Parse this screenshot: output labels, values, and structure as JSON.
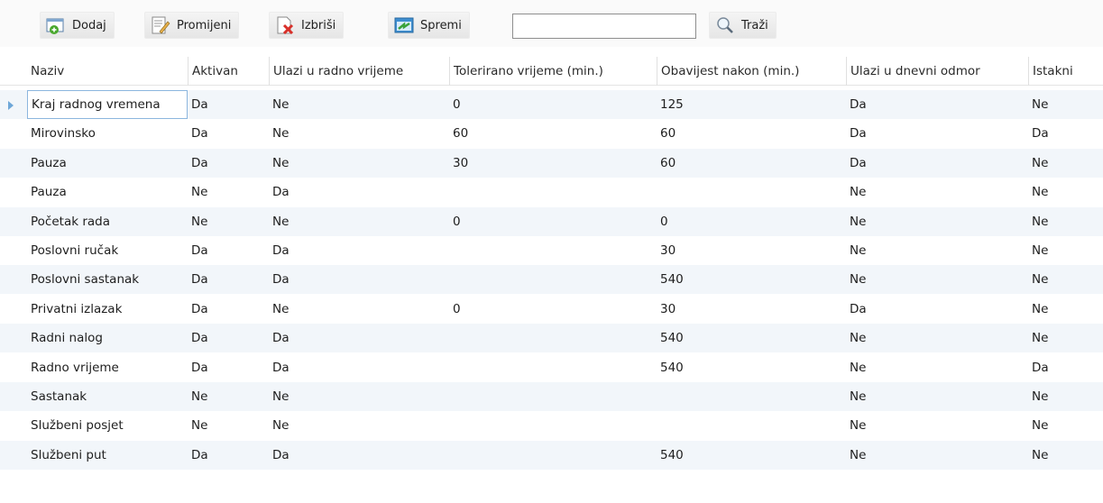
{
  "toolbar": {
    "add_label": "Dodaj",
    "edit_label": "Promijeni",
    "delete_label": "Izbriši",
    "save_label": "Spremi",
    "search_value": "",
    "search_label": "Traži"
  },
  "table": {
    "columns": [
      "Naziv",
      "Aktivan",
      "Ulazi u radno vrijeme",
      "Tolerirano vrijeme (min.)",
      "Obavijest nakon (min.)",
      "Ulazi u dnevni odmor",
      "Istakni"
    ],
    "rows": [
      [
        "Kraj radnog vremena",
        "Da",
        "Ne",
        "0",
        "125",
        "Da",
        "Ne"
      ],
      [
        "Mirovinsko",
        "Da",
        "Ne",
        "60",
        "60",
        "Da",
        "Da"
      ],
      [
        "Pauza",
        "Da",
        "Ne",
        "30",
        "60",
        "Da",
        "Ne"
      ],
      [
        "Pauza",
        "Ne",
        "Da",
        "",
        "",
        "Ne",
        "Ne"
      ],
      [
        "Početak rada",
        "Ne",
        "Ne",
        "0",
        "0",
        "Ne",
        "Ne"
      ],
      [
        "Poslovni ručak",
        "Da",
        "Da",
        "",
        "30",
        "Ne",
        "Ne"
      ],
      [
        "Poslovni sastanak",
        "Da",
        "Da",
        "",
        "540",
        "Ne",
        "Ne"
      ],
      [
        "Privatni izlazak",
        "Da",
        "Ne",
        "0",
        "30",
        "Da",
        "Ne"
      ],
      [
        "Radni nalog",
        "Da",
        "Da",
        "",
        "540",
        "Ne",
        "Ne"
      ],
      [
        "Radno vrijeme",
        "Da",
        "Da",
        "",
        "540",
        "Ne",
        "Da"
      ],
      [
        "Sastanak",
        "Ne",
        "Ne",
        "",
        "",
        "Ne",
        "Ne"
      ],
      [
        "Službeni posjet",
        "Ne",
        "Ne",
        "",
        "",
        "Ne",
        "Ne"
      ],
      [
        "Službeni put",
        "Da",
        "Da",
        "",
        "540",
        "Ne",
        "Ne"
      ]
    ]
  },
  "colors": {
    "row_alt": "#f2f6fa",
    "selection_border": "#8cb6de",
    "row_indicator": "#6ea7d8"
  },
  "icons": [
    "add-icon",
    "edit-icon",
    "delete-icon",
    "save-icon",
    "search-icon",
    "row-indicator-icon"
  ]
}
